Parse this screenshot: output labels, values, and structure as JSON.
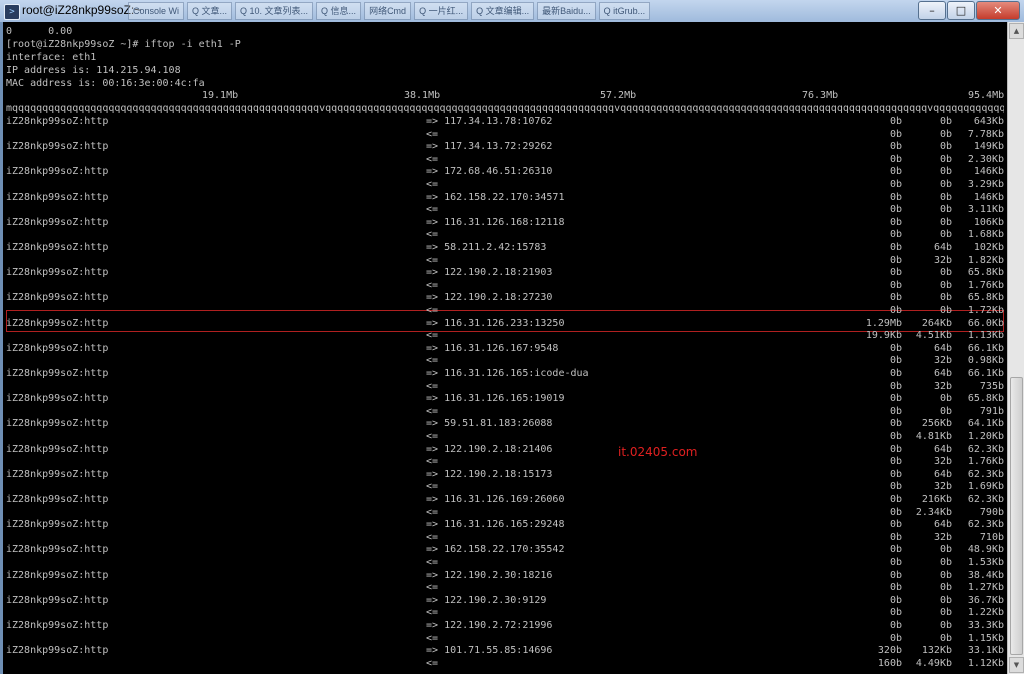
{
  "window": {
    "title": "root@iZ28nkp99soZ:~",
    "tabs": [
      "Console Wi",
      "Q 文章...",
      "Q 10. 文章列表...",
      "Q 信息...",
      "网络Cmd",
      "Q 一片红...",
      "Q 文章编辑...",
      "最新Baidu...",
      "Q itGrub..."
    ]
  },
  "controls": {
    "minimize": "–",
    "maximize": "□",
    "close": "✕"
  },
  "terminal": {
    "top_line": "0      0.00",
    "prompt": "[root@iZ28nkp99soZ ~]# iftop -i eth1 -P",
    "interface": "interface: eth1",
    "ip": "IP address is: 114.215.94.108",
    "mac": "MAC address is: 00:16:3e:00:4c:fa",
    "scale": [
      "19.1Mb",
      "38.1Mb",
      "57.2Mb",
      "76.3Mb",
      "95.4Mb"
    ],
    "ruler": "mqqqqqqqqqqqqqqqqqqqqqqqqqqqqqqqqqqqqqqqqqqqqqqqqqqqvqqqqqqqqqqqqqqqqqqqqqqqqqqqqqqqqqqqqqqqqqqqqqqqqvqqqqqqqqqqqqqqqqqqqqqqqqqqqqqqqqqqqqqqqqqqqqqqqqqqqvqqqqqqqqqqqqqqqqqqqqqqqqqqqqqqqqqqqqqqqqqqqqqqqqqqqqqvqqqqqqqqqqqqqqqqqqqqqqqqqqqqqqqqqqqqqqqqqq",
    "connections": [
      {
        "host": "iZ28nkp99soZ:http",
        "remote": "117.34.13.78:10762",
        "out": [
          "0b",
          "0b",
          "643Kb"
        ],
        "in": [
          "0b",
          "0b",
          "7.78Kb"
        ]
      },
      {
        "host": "iZ28nkp99soZ:http",
        "remote": "117.34.13.72:29262",
        "out": [
          "0b",
          "0b",
          "149Kb"
        ],
        "in": [
          "0b",
          "0b",
          "2.30Kb"
        ]
      },
      {
        "host": "iZ28nkp99soZ:http",
        "remote": "172.68.46.51:26310",
        "out": [
          "0b",
          "0b",
          "146Kb"
        ],
        "in": [
          "0b",
          "0b",
          "3.29Kb"
        ]
      },
      {
        "host": "iZ28nkp99soZ:http",
        "remote": "162.158.22.170:34571",
        "out": [
          "0b",
          "0b",
          "146Kb"
        ],
        "in": [
          "0b",
          "0b",
          "3.11Kb"
        ]
      },
      {
        "host": "iZ28nkp99soZ:http",
        "remote": "116.31.126.168:12118",
        "out": [
          "0b",
          "0b",
          "106Kb"
        ],
        "in": [
          "0b",
          "0b",
          "1.68Kb"
        ]
      },
      {
        "host": "iZ28nkp99soZ:http",
        "remote": "58.211.2.42:15783",
        "out": [
          "0b",
          "64b",
          "102Kb"
        ],
        "in": [
          "0b",
          "32b",
          "1.82Kb"
        ]
      },
      {
        "host": "iZ28nkp99soZ:http",
        "remote": "122.190.2.18:21903",
        "out": [
          "0b",
          "0b",
          "65.8Kb"
        ],
        "in": [
          "0b",
          "0b",
          "1.76Kb"
        ]
      },
      {
        "host": "iZ28nkp99soZ:http",
        "remote": "122.190.2.18:27230",
        "out": [
          "0b",
          "0b",
          "65.8Kb"
        ],
        "in": [
          "0b",
          "0b",
          "1.72Kb"
        ]
      },
      {
        "host": "iZ28nkp99soZ:http",
        "remote": "116.31.126.233:13250",
        "out": [
          "1.29Mb",
          "264Kb",
          "66.0Kb"
        ],
        "in": [
          "19.9Kb",
          "4.51Kb",
          "1.13Kb"
        ]
      },
      {
        "host": "iZ28nkp99soZ:http",
        "remote": "116.31.126.167:9548",
        "out": [
          "0b",
          "64b",
          "66.1Kb"
        ],
        "in": [
          "0b",
          "32b",
          "0.98Kb"
        ]
      },
      {
        "host": "iZ28nkp99soZ:http",
        "remote": "116.31.126.165:icode-dua",
        "out": [
          "0b",
          "64b",
          "66.1Kb"
        ],
        "in": [
          "0b",
          "32b",
          "735b"
        ]
      },
      {
        "host": "iZ28nkp99soZ:http",
        "remote": "116.31.126.165:19019",
        "out": [
          "0b",
          "0b",
          "65.8Kb"
        ],
        "in": [
          "0b",
          "0b",
          "791b"
        ]
      },
      {
        "host": "iZ28nkp99soZ:http",
        "remote": "59.51.81.183:26088",
        "out": [
          "0b",
          "256Kb",
          "64.1Kb"
        ],
        "in": [
          "0b",
          "4.81Kb",
          "1.20Kb"
        ]
      },
      {
        "host": "iZ28nkp99soZ:http",
        "remote": "122.190.2.18:21406",
        "out": [
          "0b",
          "64b",
          "62.3Kb"
        ],
        "in": [
          "0b",
          "32b",
          "1.76Kb"
        ]
      },
      {
        "host": "iZ28nkp99soZ:http",
        "remote": "122.190.2.18:15173",
        "out": [
          "0b",
          "64b",
          "62.3Kb"
        ],
        "in": [
          "0b",
          "32b",
          "1.69Kb"
        ]
      },
      {
        "host": "iZ28nkp99soZ:http",
        "remote": "116.31.126.169:26060",
        "out": [
          "0b",
          "216Kb",
          "62.3Kb"
        ],
        "in": [
          "0b",
          "2.34Kb",
          "790b"
        ]
      },
      {
        "host": "iZ28nkp99soZ:http",
        "remote": "116.31.126.165:29248",
        "out": [
          "0b",
          "64b",
          "62.3Kb"
        ],
        "in": [
          "0b",
          "32b",
          "710b"
        ]
      },
      {
        "host": "iZ28nkp99soZ:http",
        "remote": "162.158.22.170:35542",
        "out": [
          "0b",
          "0b",
          "48.9Kb"
        ],
        "in": [
          "0b",
          "0b",
          "1.53Kb"
        ]
      },
      {
        "host": "iZ28nkp99soZ:http",
        "remote": "122.190.2.30:18216",
        "out": [
          "0b",
          "0b",
          "38.4Kb"
        ],
        "in": [
          "0b",
          "0b",
          "1.27Kb"
        ]
      },
      {
        "host": "iZ28nkp99soZ:http",
        "remote": "122.190.2.30:9129",
        "out": [
          "0b",
          "0b",
          "36.7Kb"
        ],
        "in": [
          "0b",
          "0b",
          "1.22Kb"
        ]
      },
      {
        "host": "iZ28nkp99soZ:http",
        "remote": "122.190.2.72:21996",
        "out": [
          "0b",
          "0b",
          "33.3Kb"
        ],
        "in": [
          "0b",
          "0b",
          "1.15Kb"
        ]
      },
      {
        "host": "iZ28nkp99soZ:http",
        "remote": "101.71.55.85:14696",
        "out": [
          "320b",
          "132Kb",
          "33.1Kb"
        ],
        "in": [
          "160b",
          "4.49Kb",
          "1.12Kb"
        ]
      }
    ]
  },
  "watermark": "it.02405.com",
  "scrollbar": {
    "up": "▲",
    "down": "▼"
  }
}
